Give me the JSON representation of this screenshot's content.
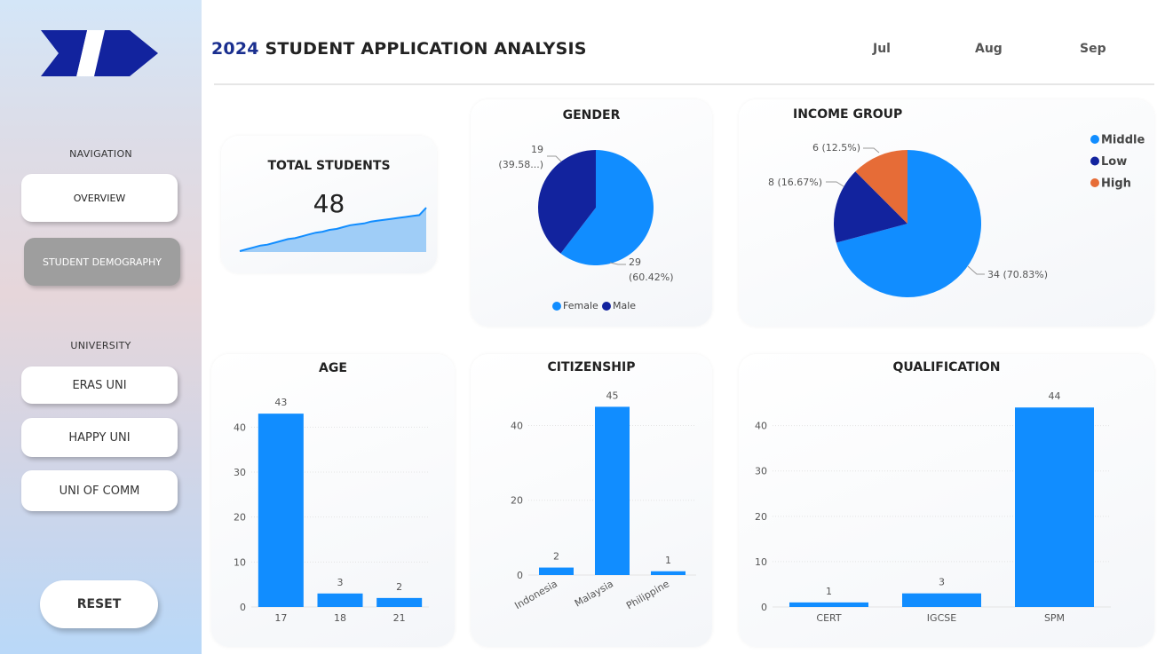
{
  "header": {
    "title_year": "2024",
    "title_text": " STUDENT APPLICATION ANALYSIS",
    "months": [
      "Jul",
      "Aug",
      "Sep"
    ]
  },
  "sidebar": {
    "navigation_heading": "NAVIGATION",
    "nav_items": [
      "OVERVIEW",
      "STUDENT DEMOGRAPHY"
    ],
    "active_nav": "STUDENT DEMOGRAPHY",
    "university_heading": "UNIVERSITY",
    "universities": [
      "ERAS UNI",
      "HAPPY UNI",
      "UNI OF COMM"
    ],
    "reset_label": "RESET"
  },
  "colors": {
    "primary_blue": "#118dff",
    "dark_blue": "#12239e",
    "orange": "#e66c37",
    "title_blue": "#1a2f8f",
    "area_fill": "#9fcdf7"
  },
  "cards": {
    "total_students": {
      "title": "TOTAL STUDENTS",
      "value": "48"
    },
    "gender": {
      "title": "GENDER"
    },
    "income": {
      "title": "INCOME GROUP"
    },
    "age": {
      "title": "AGE"
    },
    "citizenship": {
      "title": "CITIZENSHIP"
    },
    "qualification": {
      "title": "QUALIFICATION"
    }
  },
  "chart_data": [
    {
      "id": "total_trend",
      "type": "area",
      "values": [
        1,
        3,
        5,
        7,
        8,
        10,
        12,
        14,
        15,
        17,
        19,
        21,
        22,
        24,
        25,
        27,
        29,
        30,
        31,
        33,
        34,
        35,
        36,
        37,
        38,
        39,
        40,
        48
      ],
      "ylim": [
        0,
        50
      ]
    },
    {
      "id": "gender",
      "type": "pie",
      "categories": [
        "Female",
        "Male"
      ],
      "values": [
        29,
        19
      ],
      "labels": [
        "29\n(60.42%)",
        "19\n(39.58...)"
      ],
      "legend": "bottom"
    },
    {
      "id": "income",
      "type": "pie",
      "categories": [
        "Middle",
        "Low",
        "High"
      ],
      "values": [
        34,
        8,
        6
      ],
      "labels": [
        "34 (70.83%)",
        "8 (16.67%)",
        "6 (12.5%)"
      ],
      "legend": "top-right"
    },
    {
      "id": "age",
      "type": "bar",
      "categories": [
        "17",
        "18",
        "21"
      ],
      "values": [
        43,
        3,
        2
      ],
      "ylim": [
        0,
        45
      ],
      "yticks": [
        0,
        10,
        20,
        30,
        40
      ]
    },
    {
      "id": "citizenship",
      "type": "bar",
      "categories": [
        "Indonesia",
        "Malaysia",
        "Philippine"
      ],
      "values": [
        2,
        45,
        1
      ],
      "ylim": [
        0,
        47
      ],
      "yticks": [
        0,
        20,
        40
      ]
    },
    {
      "id": "qualification",
      "type": "bar",
      "categories": [
        "CERT",
        "IGCSE",
        "SPM"
      ],
      "values": [
        1,
        3,
        44
      ],
      "ylim": [
        0,
        46
      ],
      "yticks": [
        0,
        10,
        20,
        30,
        40
      ]
    }
  ]
}
